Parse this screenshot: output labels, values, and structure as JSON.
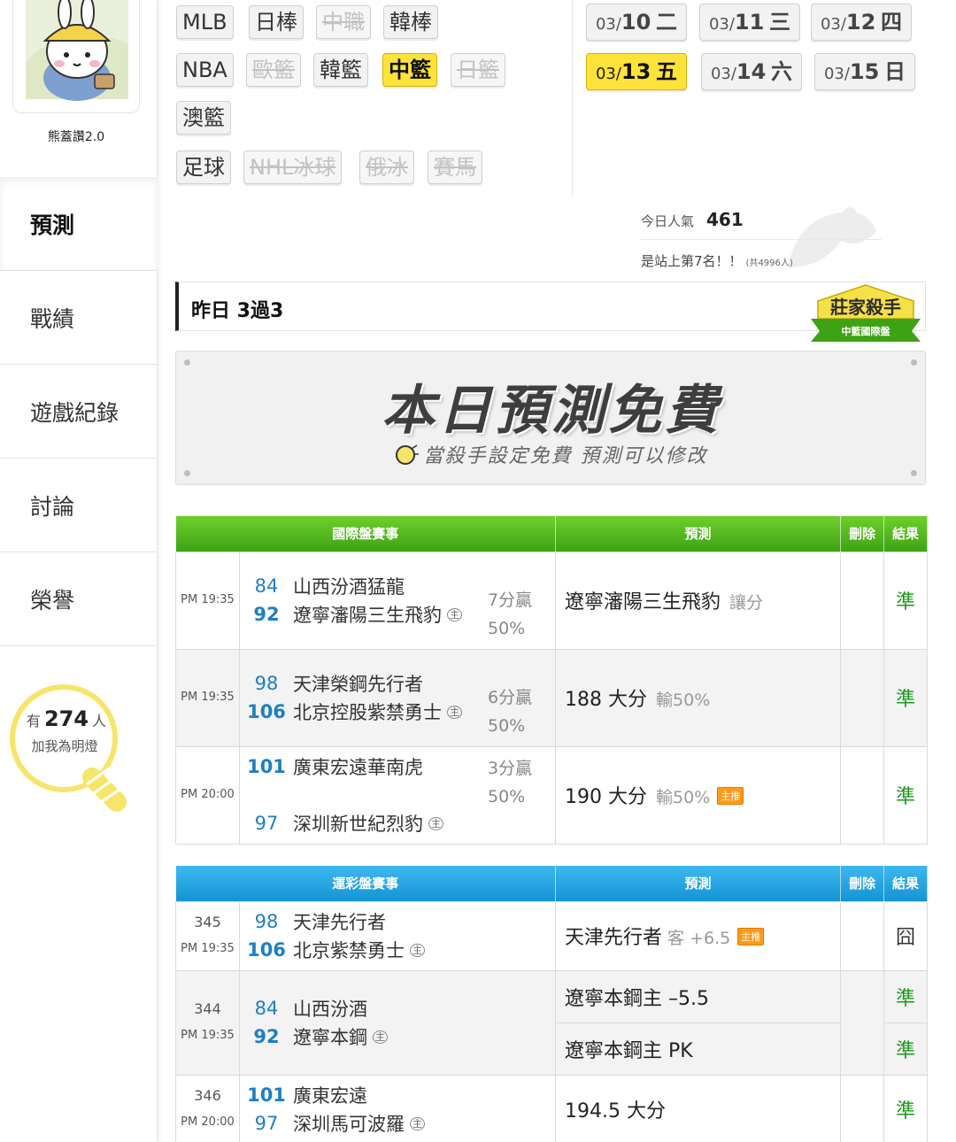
{
  "user": {
    "name": "熊蓋讚2.0"
  },
  "nav": {
    "items": [
      {
        "label": "預測"
      },
      {
        "label": "戰績"
      },
      {
        "label": "遊戲紀錄"
      },
      {
        "label": "討論"
      },
      {
        "label": "榮譽"
      }
    ]
  },
  "fans": {
    "prefix": "有",
    "count": "274",
    "suffix": "人",
    "sub": "加我為明燈"
  },
  "leagues": {
    "row1": [
      {
        "label": "MLB",
        "state": "normal"
      },
      {
        "label": "日棒",
        "state": "normal"
      },
      {
        "label": "中職",
        "state": "disabled"
      },
      {
        "label": "韓棒",
        "state": "normal"
      }
    ],
    "row2": [
      {
        "label": "NBA",
        "state": "normal"
      },
      {
        "label": "歐籃",
        "state": "disabled"
      },
      {
        "label": "韓籃",
        "state": "normal"
      },
      {
        "label": "中籃",
        "state": "active"
      },
      {
        "label": "日籃",
        "state": "disabled"
      }
    ],
    "row3": [
      {
        "label": "澳籃",
        "state": "normal"
      }
    ],
    "row4": [
      {
        "label": "足球",
        "state": "normal"
      },
      {
        "label": "NHL冰球",
        "state": "disabled"
      },
      {
        "label": "俄冰",
        "state": "disabled"
      },
      {
        "label": "賽馬",
        "state": "disabled"
      }
    ]
  },
  "dates": [
    {
      "md": "03/",
      "day": "10",
      "wd": "二",
      "active": false
    },
    {
      "md": "03/",
      "day": "11",
      "wd": "三",
      "active": false
    },
    {
      "md": "03/",
      "day": "12",
      "wd": "四",
      "active": false
    },
    {
      "md": "03/",
      "day": "13",
      "wd": "五",
      "active": true
    },
    {
      "md": "03/",
      "day": "14",
      "wd": "六",
      "active": false
    },
    {
      "md": "03/",
      "day": "15",
      "wd": "日",
      "active": false
    }
  ],
  "stats": {
    "popular_label": "今日人氣",
    "popular_value": "461",
    "rank_text": "是站上第7名！！",
    "rank_total": "(共4996人)"
  },
  "yesterday": {
    "text": "昨日 3過3"
  },
  "badge": {
    "title": "莊家殺手",
    "sub": "中籃國際盤"
  },
  "banner": {
    "title": "本日預測免費",
    "sub": "當殺手設定免費 預測可以修改"
  },
  "colors": {
    "accent_yellow": "#ffe33a",
    "intl_green": "#4fb51f",
    "lottery_blue": "#23a2e0",
    "result_green": "#1a9a1a",
    "score_blue": "#1e7fc4"
  },
  "intl_table": {
    "headers": [
      "國際盤賽事",
      "預測",
      "刪除",
      "結果"
    ],
    "rows": [
      {
        "time": "PM 19:35",
        "away_score": "84",
        "away": "山西汾酒猛龍",
        "home_score": "92",
        "home": "遼寧瀋陽三生飛豹",
        "home_mark": "主",
        "odds1": "7分贏",
        "odds2": "50%",
        "pick": "遼寧瀋陽三生飛豹",
        "note": "讓分",
        "main": false,
        "result": "準"
      },
      {
        "time": "PM 19:35",
        "away_score": "98",
        "away": "天津榮鋼先行者",
        "home_score": "106",
        "home": "北京控股紫禁勇士",
        "home_mark": "主",
        "odds1": "6分贏",
        "odds2": "50%",
        "pick": "188 大分",
        "note": "輸50%",
        "main": false,
        "result": "準"
      },
      {
        "time": "PM 20:00",
        "away_score": "101",
        "away": "廣東宏遠華南虎",
        "home_score": "97",
        "home": "深圳新世紀烈豹",
        "home_mark": "主",
        "odds1": "3分贏",
        "odds2": "50%",
        "pick": "190 大分",
        "note": "輸50%",
        "main": true,
        "main_label": "主推",
        "result": "準"
      }
    ]
  },
  "lottery_table": {
    "headers": [
      "運彩盤賽事",
      "預測",
      "刪除",
      "結果"
    ],
    "rows": [
      {
        "no": "345",
        "time": "PM 19:35",
        "away_score": "98",
        "away": "天津先行者",
        "home_score": "106",
        "home": "北京紫禁勇士",
        "home_mark": "主",
        "picks": [
          {
            "team": "天津先行者",
            "note": "客 +6.5",
            "main": true,
            "main_label": "主推",
            "result": "囧"
          }
        ]
      },
      {
        "no": "344",
        "time": "PM 19:35",
        "away_score": "84",
        "away": "山西汾酒",
        "home_score": "92",
        "home": "遼寧本鋼",
        "home_mark": "主",
        "picks": [
          {
            "team": "遼寧本鋼",
            "note": "主 –5.5",
            "main": false,
            "result": "準"
          },
          {
            "team": "遼寧本鋼",
            "note": "主 PK",
            "main": false,
            "result": "準"
          }
        ]
      },
      {
        "no": "346",
        "time": "PM 20:00",
        "away_score": "101",
        "away": "廣東宏遠",
        "home_score": "97",
        "home": "深圳馬可波羅",
        "home_mark": "主",
        "picks": [
          {
            "team": "194.5 大分",
            "note": "",
            "main": false,
            "result": "準"
          }
        ]
      }
    ]
  }
}
